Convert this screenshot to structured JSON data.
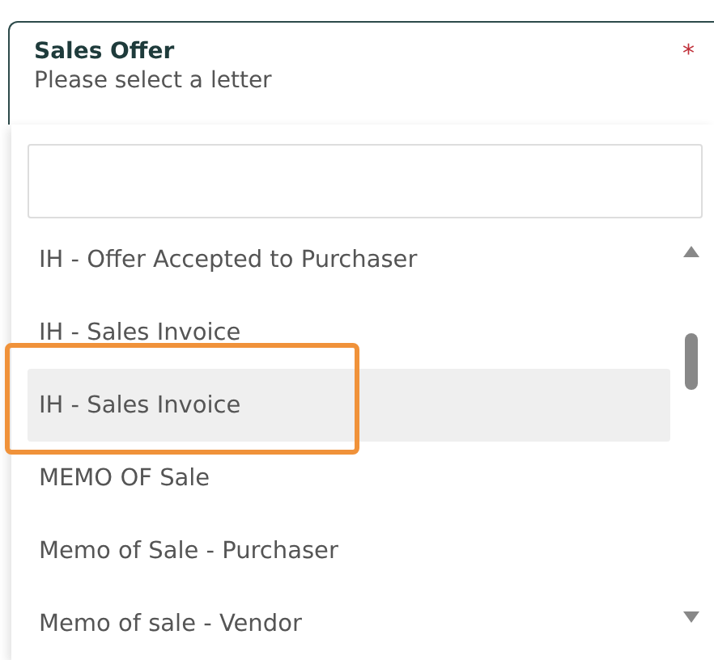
{
  "field": {
    "label": "Sales Offer",
    "placeholder": "Please select a letter",
    "required_mark": "*"
  },
  "options": [
    {
      "label": "IH - Offer Accepted to Purchaser",
      "selected": false
    },
    {
      "label": "IH - Sales Invoice",
      "selected": false
    },
    {
      "label": "IH - Sales Invoice",
      "selected": true,
      "highlighted": true
    },
    {
      "label": "MEMO OF Sale",
      "selected": false
    },
    {
      "label": "Memo of Sale - Purchaser",
      "selected": false
    },
    {
      "label": "Memo of sale - Vendor",
      "selected": false
    }
  ]
}
